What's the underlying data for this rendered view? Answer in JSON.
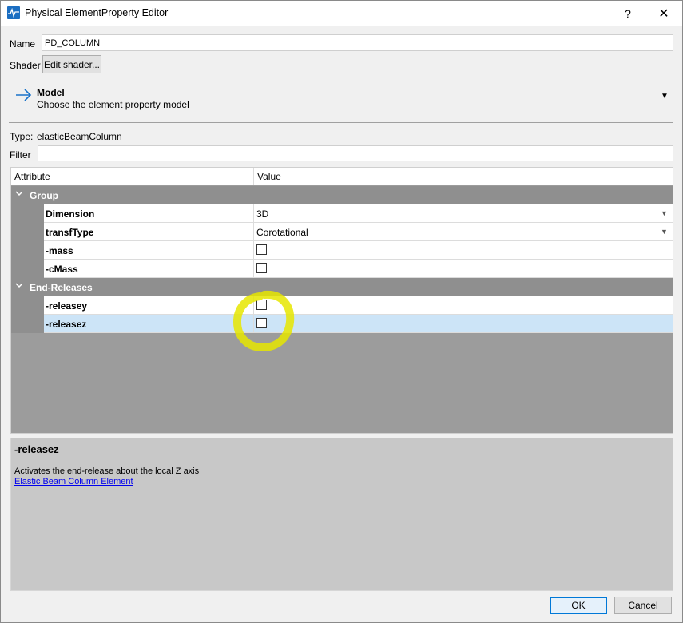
{
  "window": {
    "title": "Physical ElementProperty Editor",
    "help_label": "?",
    "close_label": "✕"
  },
  "form": {
    "name_label": "Name",
    "name_value": "PD_COLUMN",
    "shader_label": "Shader",
    "edit_shader_label": "Edit shader..."
  },
  "model": {
    "title": "Model",
    "subtitle": "Choose the element property model",
    "dropdown_icon": "▼"
  },
  "type": {
    "label": "Type:",
    "value": "elasticBeamColumn"
  },
  "filter": {
    "label": "Filter",
    "value": ""
  },
  "grid": {
    "columns": [
      "Attribute",
      "Value"
    ],
    "groups": [
      {
        "name": "Group",
        "rows": [
          {
            "attribute": "Dimension",
            "value": "3D",
            "kind": "dropdown"
          },
          {
            "attribute": "transfType",
            "value": "Corotational",
            "kind": "dropdown"
          },
          {
            "attribute": "-mass",
            "checked": false,
            "kind": "checkbox"
          },
          {
            "attribute": "-cMass",
            "checked": false,
            "kind": "checkbox"
          }
        ]
      },
      {
        "name": "End-Releases",
        "rows": [
          {
            "attribute": "-releasey",
            "checked": false,
            "kind": "checkbox"
          },
          {
            "attribute": "-releasez",
            "checked": false,
            "kind": "checkbox",
            "selected": true
          }
        ]
      }
    ]
  },
  "description": {
    "title": "-releasez",
    "text": "Activates the end-release about the local Z axis",
    "link": "Elastic Beam Column Element"
  },
  "buttons": {
    "ok": "OK",
    "cancel": "Cancel"
  },
  "colors": {
    "accent": "#0078d7",
    "selection": "#cce4f7",
    "group_header": "#8f8f8f",
    "highlight_marker": "#e6e600"
  }
}
